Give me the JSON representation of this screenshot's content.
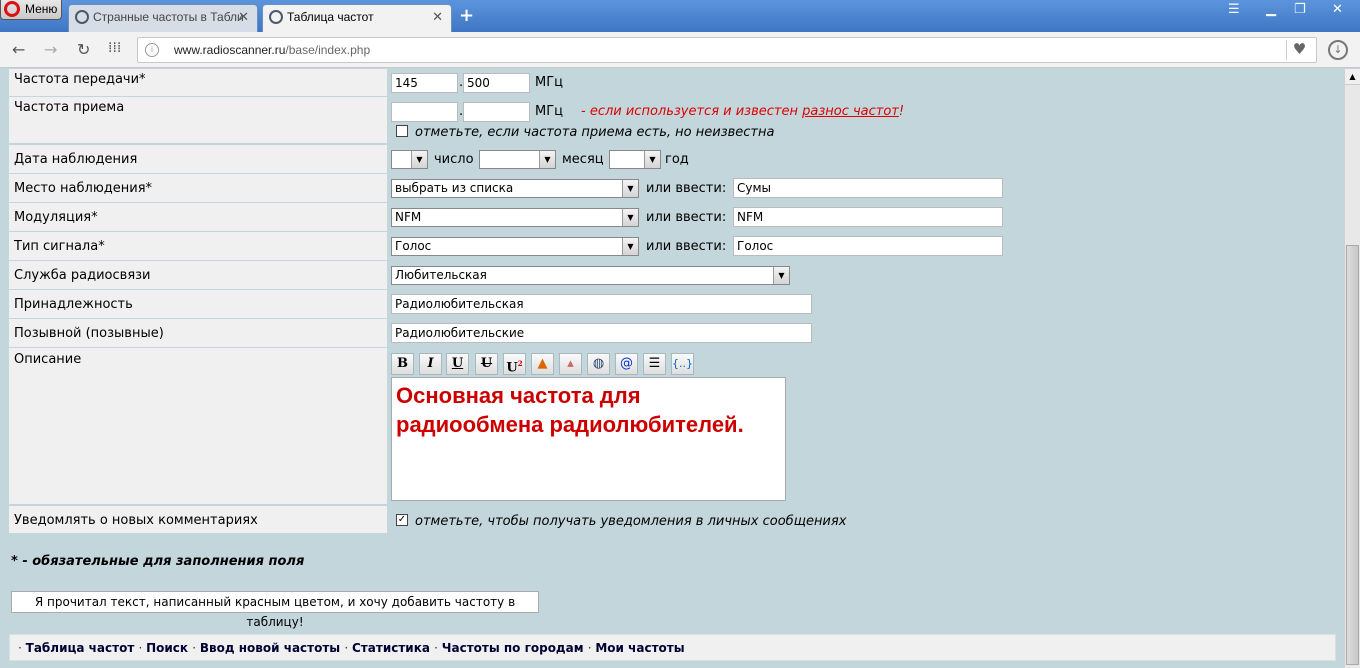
{
  "browser": {
    "menu_label": "Меню",
    "tabs": [
      {
        "title": "Странные частоты в Табли",
        "active": false
      },
      {
        "title": "Таблица частот",
        "active": true
      }
    ],
    "url_domain": "www.radioscanner.ru",
    "url_path": "/base/index.php"
  },
  "form": {
    "tx_freq": {
      "label": "Частота передачи*",
      "mhz": "145",
      "khz": "500",
      "unit": "МГц"
    },
    "rx_freq": {
      "label": "Частота приема",
      "mhz": "",
      "khz": "",
      "unit": "МГц",
      "note_prefix": "- если используется и известен ",
      "note_link": "разнос частот",
      "note_suffix": "!",
      "unknown_label": "отметьте, если частота приема есть, но неизвестна",
      "unknown_checked": false
    },
    "date": {
      "label": "Дата наблюдения",
      "day_label": "число",
      "month_label": "месяц",
      "year_label": "год"
    },
    "place": {
      "label": "Место наблюдения*",
      "select": "выбрать из списка",
      "or_label": "или ввести:",
      "value": "Сумы"
    },
    "modulation": {
      "label": "Модуляция*",
      "select": "NFM",
      "or_label": "или ввести:",
      "value": "NFM"
    },
    "signal": {
      "label": "Тип сигнала*",
      "select": "Голос",
      "or_label": "или ввести:",
      "value": "Голос"
    },
    "service": {
      "label": "Служба радиосвязи",
      "select": "Любительская"
    },
    "owner": {
      "label": "Принадлежность",
      "value": "Радиолюбительская"
    },
    "callsign": {
      "label": "Позывной (позывные)",
      "value": "Радиолюбительские"
    },
    "description": {
      "label": "Описание",
      "text": "Основная частота для радиообмена радиолюбителей."
    },
    "notify": {
      "label": "Уведомлять о новых комментариях",
      "checkbox_label": "отметьте, чтобы получать уведомления в личных сообщениях",
      "checked": true
    },
    "required_note": "* - обязательные для заполнения поля",
    "submit_label": "Я прочитал текст, написанный красным цветом, и хочу добавить частоту в таблицу!"
  },
  "footer_links": [
    "Таблица частот",
    "Поиск",
    "Ввод новой частоты",
    "Статистика",
    "Частоты по городам",
    "Мои частоты"
  ],
  "colors": {
    "page_bg": "#c2d6dc",
    "label_bg": "#f0f0f0",
    "note_red": "#dd0000",
    "titlebar": "#4a82cf"
  }
}
